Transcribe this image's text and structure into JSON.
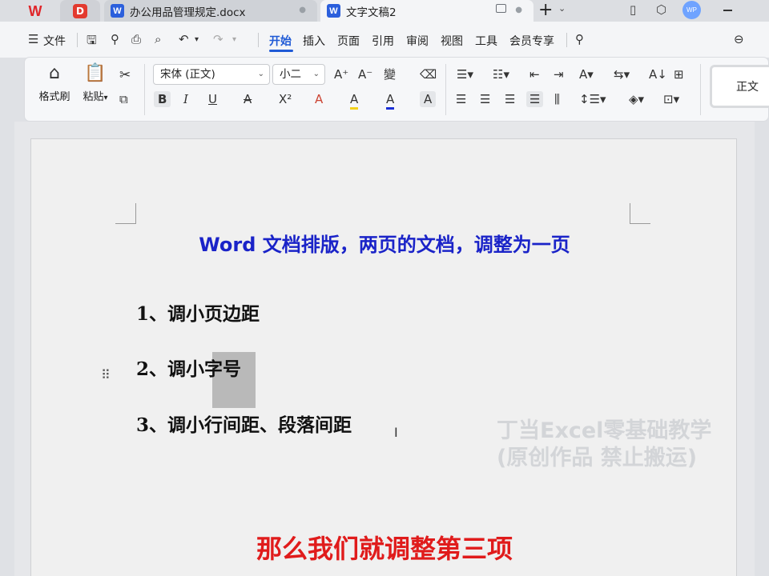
{
  "titlebar": {
    "tabs": [
      {
        "title": "办公用品管理规定.docx",
        "icon": "W"
      },
      {
        "title": "文字文稿2",
        "icon": "W"
      }
    ],
    "logo_home": "W",
    "avatar_text": "WP"
  },
  "menubar": {
    "file_label": "文件",
    "items": [
      "开始",
      "插入",
      "页面",
      "引用",
      "审阅",
      "视图",
      "工具",
      "会员专享"
    ],
    "active_index": 0
  },
  "ribbon": {
    "format_painter": "格式刷",
    "paste": "粘贴",
    "font_name": "宋体 (正文)",
    "font_size": "小二",
    "style_preview": "正文",
    "bold": "B",
    "italic": "I",
    "underline": "U",
    "strike": "A",
    "superscript": "X²",
    "grow_font": "A⁺",
    "shrink_font": "A⁻",
    "pinyin": "變",
    "text_effect": "A",
    "highlight": "A",
    "font_color": "A",
    "char_shading": "A",
    "sort": "A↓"
  },
  "document": {
    "title": "Word 文档排版，两页的文档，调整为一页",
    "items": [
      "1、调小页边距",
      "2、调小字号",
      "3、调小行间距、段落间距"
    ],
    "watermark_line1": "丁当Excel零基础教学",
    "watermark_line2": "(原创作品  禁止搬运)"
  },
  "subtitle": "那么我们就调整第三项",
  "colors": {
    "accent": "#1f5ad6",
    "title_blue": "#1a23c8",
    "subtitle_red": "#e01b1b",
    "wps_red": "#e0262a"
  }
}
